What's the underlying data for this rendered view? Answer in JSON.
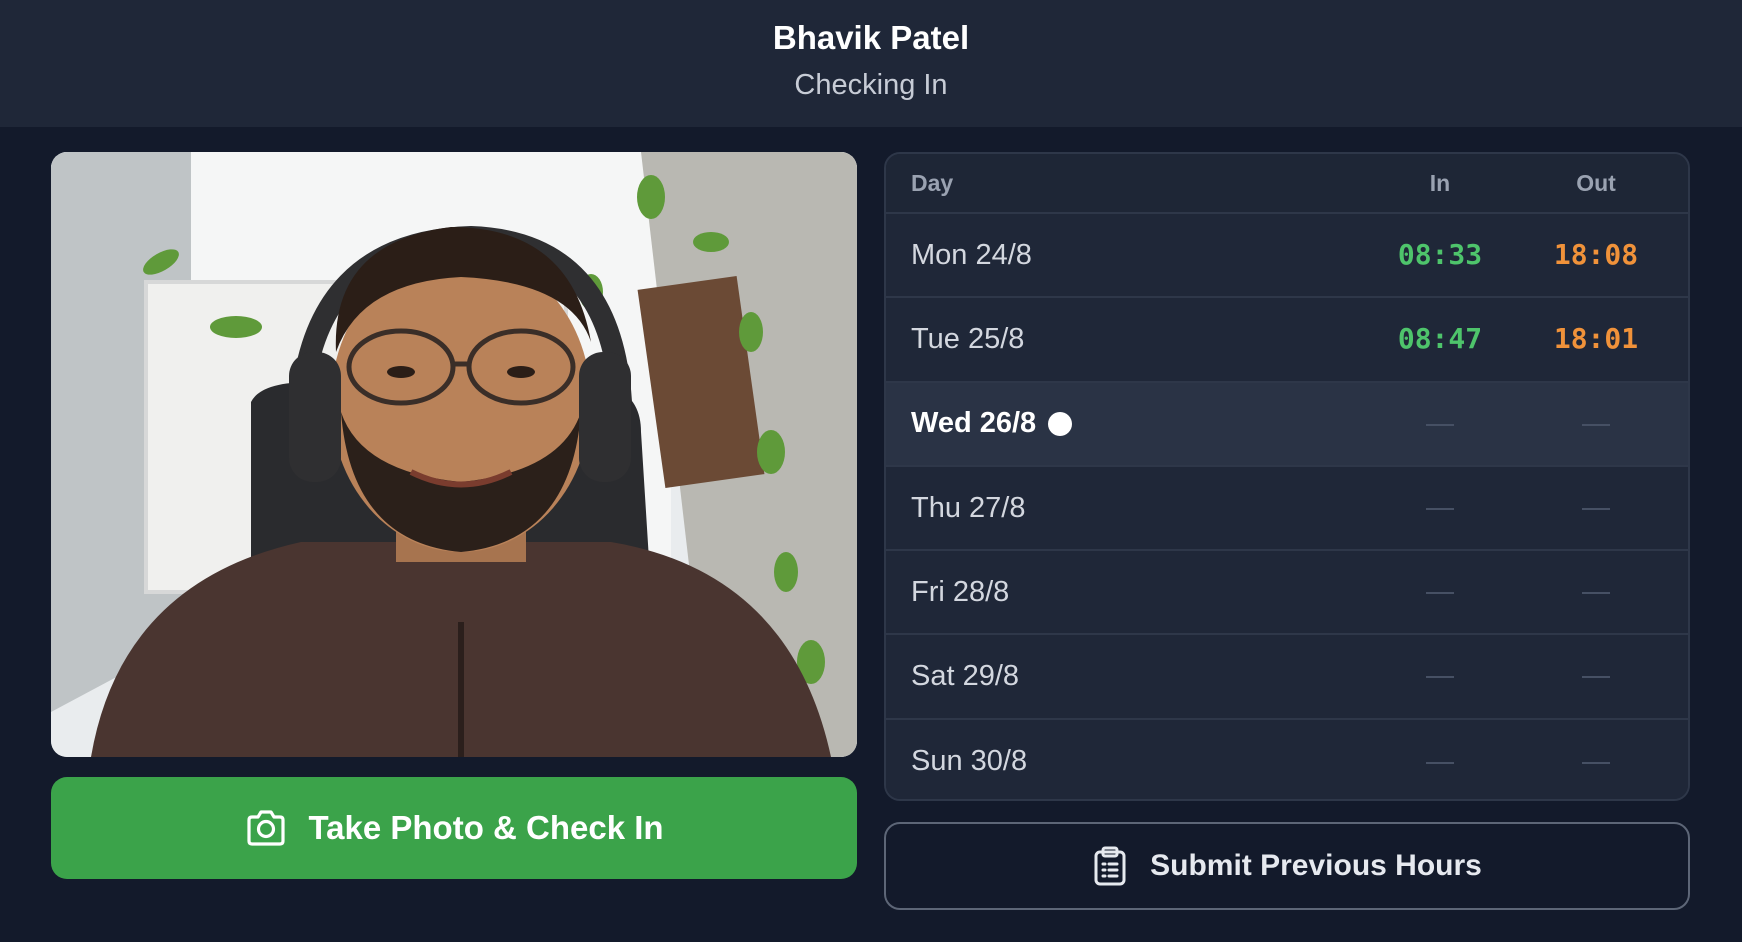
{
  "header": {
    "name": "Bhavik Patel",
    "status": "Checking In"
  },
  "camera": {
    "alt": "Live camera preview of user"
  },
  "checkin_button": {
    "label": "Take Photo & Check In",
    "icon": "camera-icon",
    "color": "#3ba34a"
  },
  "schedule": {
    "columns": {
      "day": "Day",
      "in": "In",
      "out": "Out"
    },
    "rows": [
      {
        "day": "Mon 24/8",
        "in": "08:33",
        "out": "18:08"
      },
      {
        "day": "Tue 25/8",
        "in": "08:47",
        "out": "18:01"
      },
      {
        "day": "Wed 26/8",
        "in": "",
        "out": "",
        "today": true
      },
      {
        "day": "Thu 27/8",
        "in": "",
        "out": ""
      },
      {
        "day": "Fri 28/8",
        "in": "",
        "out": ""
      },
      {
        "day": "Sat 29/8",
        "in": "",
        "out": ""
      },
      {
        "day": "Sun 30/8",
        "in": "",
        "out": ""
      }
    ],
    "in_color": "#4ec46b",
    "out_color": "#f0923a"
  },
  "submit_button": {
    "label": "Submit Previous Hours",
    "icon": "clipboard-icon"
  }
}
